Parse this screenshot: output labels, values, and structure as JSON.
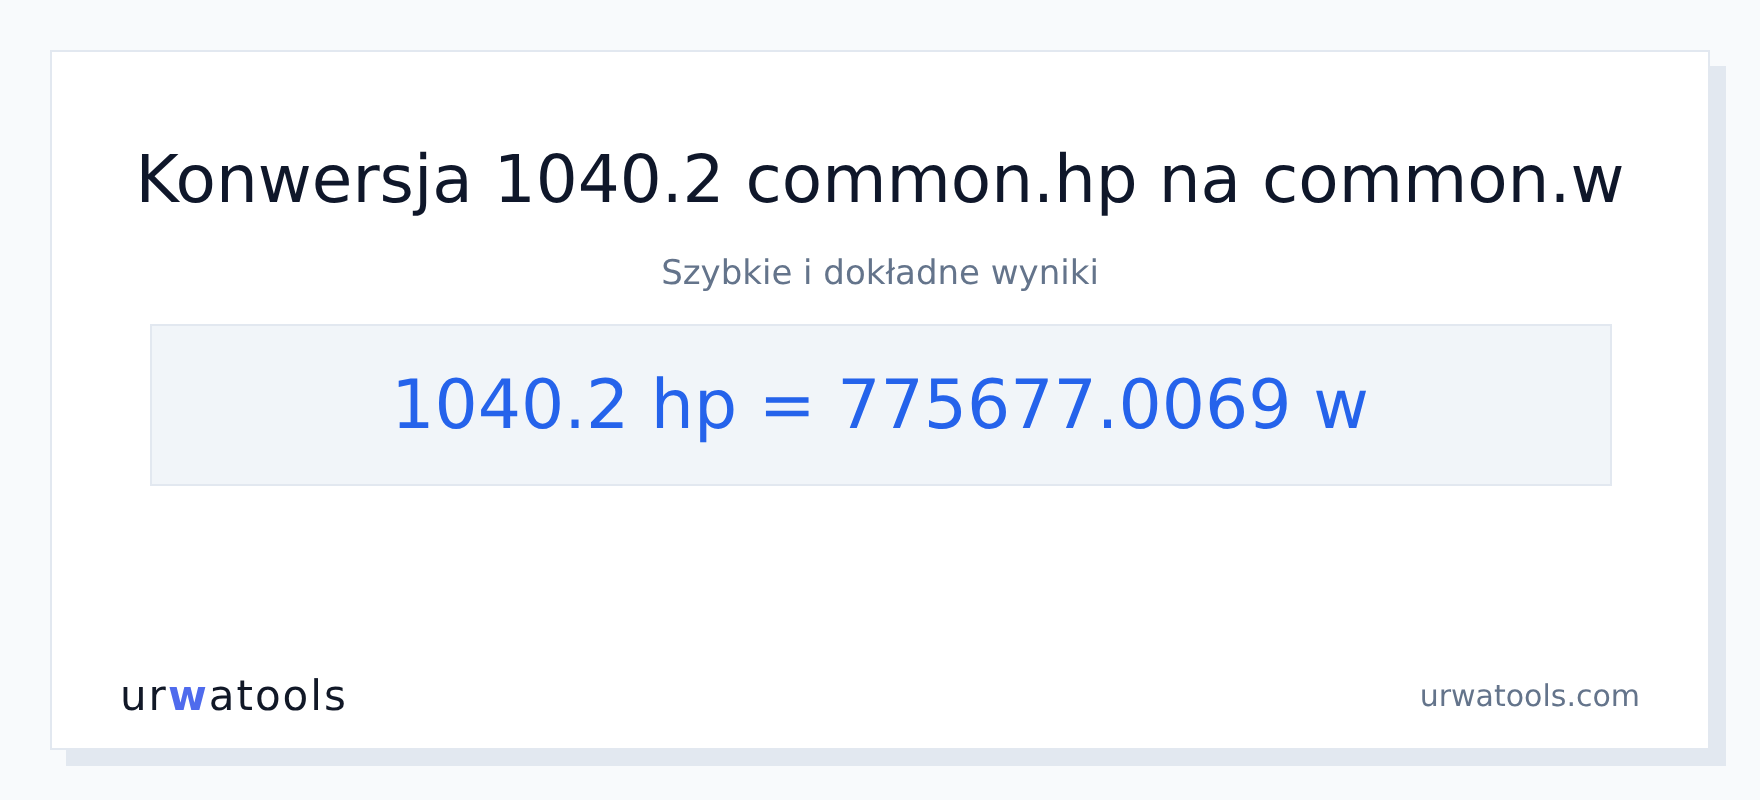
{
  "title": "Konwersja 1040.2 common.hp na common.w",
  "subtitle": "Szybkie i dokładne wyniki",
  "result": "1040.2 hp = 775677.0069 w",
  "logo": [
    {
      "text": "ur",
      "accent": false
    },
    {
      "text": "w",
      "accent": true
    },
    {
      "text": "atools",
      "accent": false
    }
  ],
  "site": "urwatools.com"
}
